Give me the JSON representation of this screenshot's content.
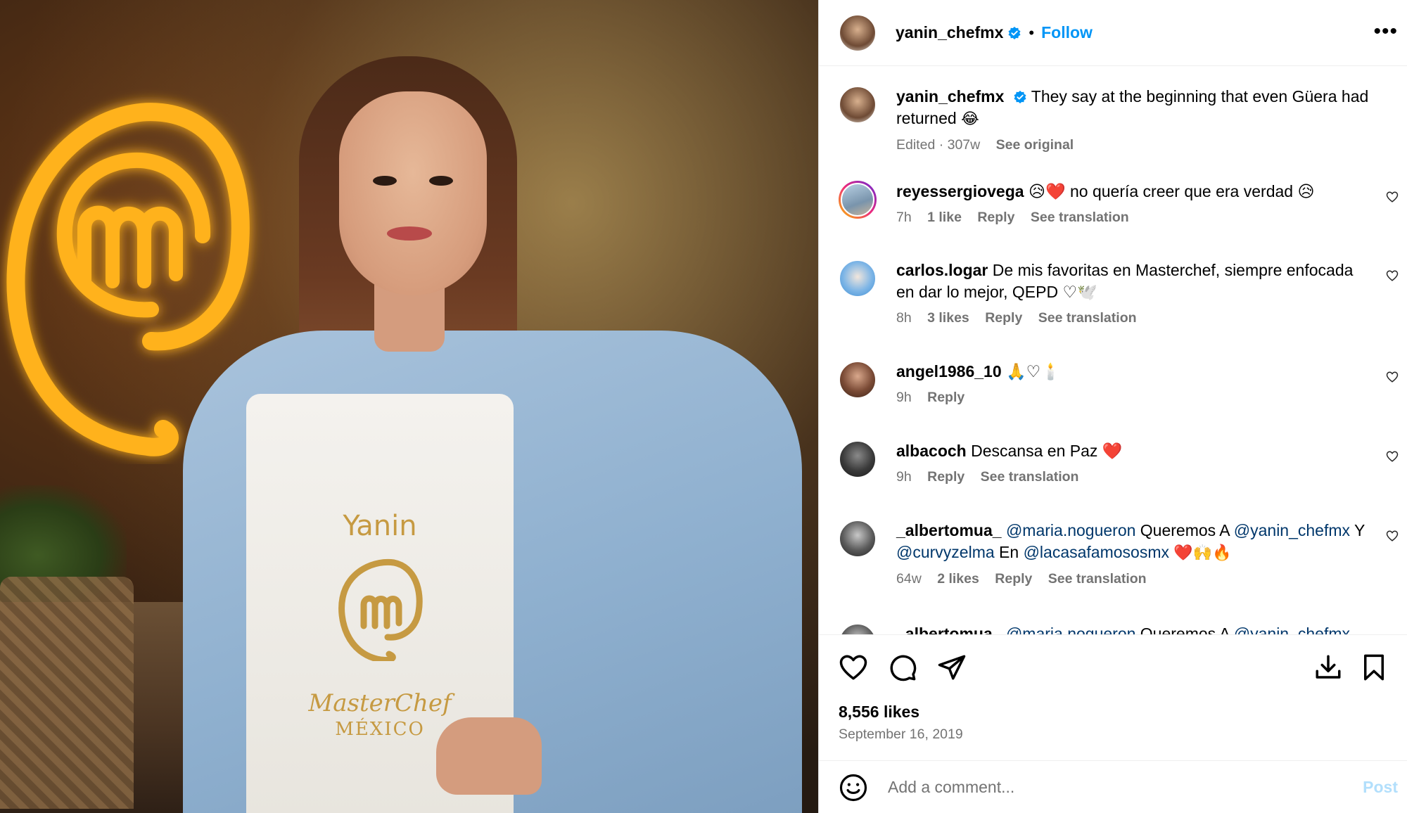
{
  "post": {
    "username": "yanin_chefmx",
    "follow_label": "Follow",
    "separator": "•",
    "more_label": "•••",
    "apron": {
      "name": "Yanin",
      "brand": "MasterChef",
      "country": "MÉXICO"
    }
  },
  "caption": {
    "username": "yanin_chefmx",
    "text": "They say at the beginning that even Güera had returned",
    "emoji": "😂",
    "meta_edited": "Edited · 307w",
    "see_original": "See original"
  },
  "comments": [
    {
      "username": "reyessergiovega",
      "text": "😥❤️ no quería creer que era verdad 😥",
      "time": "7h",
      "likes": "1 like",
      "reply": "Reply",
      "translate": "See translation"
    },
    {
      "username": "carlos.logar",
      "text": "De mis favoritas en Masterchef, siempre enfocada en dar lo mejor, QEPD ♡🕊️",
      "time": "8h",
      "likes": "3 likes",
      "reply": "Reply",
      "translate": "See translation"
    },
    {
      "username": "angel1986_10",
      "text": "🙏♡🕯️",
      "time": "9h",
      "reply": "Reply"
    },
    {
      "username": "albacoch",
      "text": "Descansa en Paz ❤️",
      "time": "9h",
      "reply": "Reply",
      "translate": "See translation"
    },
    {
      "username": "_albertomua_",
      "mention1": "@maria.nogueron",
      "text1": "Queremos A",
      "mention2": "@yanin_chefmx",
      "text2": "Y",
      "mention3": "@curvyzelma",
      "text3": "En",
      "mention4": "@lacasafamososmx",
      "emoji": "❤️🙌🔥",
      "time": "64w",
      "likes": "2 likes",
      "reply": "Reply",
      "translate": "See translation"
    },
    {
      "username": "_albertomua_",
      "mention1": "@maria.nogueron",
      "text1": "Queremos A",
      "mention2": "@yanin_chefmx"
    }
  ],
  "actions": {
    "likes": "8,556 likes",
    "date": "September 16, 2019"
  },
  "composer": {
    "placeholder": "Add a comment...",
    "post_label": "Post"
  },
  "colors": {
    "accent": "#0095f6",
    "mention": "#00376b",
    "muted": "#737373",
    "post_disabled": "#b2dffc",
    "heart_red": "#e0245e",
    "logo_glow": "#ffb21f"
  }
}
